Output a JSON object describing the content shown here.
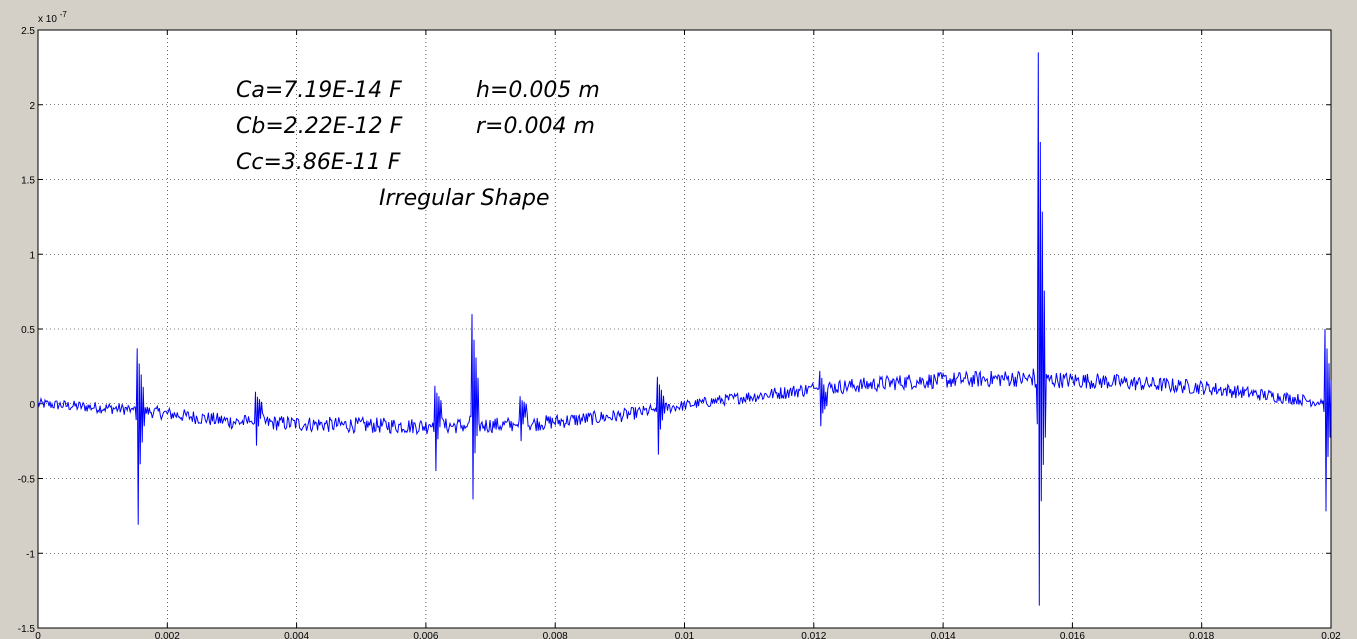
{
  "chart_data": {
    "type": "line",
    "title": "",
    "xlabel": "",
    "ylabel": "",
    "xlim": [
      0,
      0.02
    ],
    "ylim": [
      -1.5e-07,
      2.5e-07
    ],
    "y_exponent_label": "x 10",
    "y_exponent_power": "-7",
    "grid": true,
    "line_color": "#0000ff",
    "x_ticks": [
      {
        "value": 0,
        "label": "0"
      },
      {
        "value": 0.002,
        "label": "0.002"
      },
      {
        "value": 0.004,
        "label": "0.004"
      },
      {
        "value": 0.006,
        "label": "0.006"
      },
      {
        "value": 0.008,
        "label": "0.008"
      },
      {
        "value": 0.01,
        "label": "0.01"
      },
      {
        "value": 0.012,
        "label": "0.012"
      },
      {
        "value": 0.014,
        "label": "0.014"
      },
      {
        "value": 0.016,
        "label": "0.016"
      },
      {
        "value": 0.018,
        "label": "0.018"
      },
      {
        "value": 0.02,
        "label": "0.02"
      }
    ],
    "y_ticks": [
      {
        "value": 2.5,
        "label": "2.5"
      },
      {
        "value": 2,
        "label": "2"
      },
      {
        "value": 1.5,
        "label": "1.5"
      },
      {
        "value": 1,
        "label": "1"
      },
      {
        "value": 0.5,
        "label": "0.5"
      },
      {
        "value": 0,
        "label": "0"
      },
      {
        "value": -0.5,
        "label": "-0.5"
      },
      {
        "value": -1,
        "label": "-1"
      },
      {
        "value": -1.5,
        "label": "-1.5"
      }
    ],
    "annotations": [
      {
        "text": "Ca=7.19E-14 F"
      },
      {
        "text": "Cb=2.22E-12 F"
      },
      {
        "text": "Cc=3.86E-11 F"
      },
      {
        "text": "h=0.005 m"
      },
      {
        "text": "r=0.004 m"
      },
      {
        "text": "Irregular Shape"
      }
    ],
    "series": [
      {
        "values_scale": "1e-7",
        "baseline": [
          [
            0.0,
            0.0
          ],
          [
            0.0015,
            -0.04
          ],
          [
            0.003,
            -0.12
          ],
          [
            0.0045,
            -0.14
          ],
          [
            0.006,
            -0.15
          ],
          [
            0.0075,
            -0.14
          ],
          [
            0.009,
            -0.08
          ],
          [
            0.0097,
            -0.03
          ],
          [
            0.0105,
            0.02
          ],
          [
            0.012,
            0.1
          ],
          [
            0.0135,
            0.15
          ],
          [
            0.015,
            0.17
          ],
          [
            0.0165,
            0.15
          ],
          [
            0.018,
            0.11
          ],
          [
            0.0195,
            0.03
          ],
          [
            0.02,
            0.0
          ]
        ],
        "peaks": [
          {
            "x": 0.00153,
            "max": 0.37,
            "min": -0.81
          },
          {
            "x": 0.00336,
            "max": 0.08,
            "min": -0.28
          },
          {
            "x": 0.00614,
            "max": 0.12,
            "min": -0.45
          },
          {
            "x": 0.00672,
            "max": 0.6,
            "min": -0.64
          },
          {
            "x": 0.00745,
            "max": 0.05,
            "min": -0.25
          },
          {
            "x": 0.00958,
            "max": 0.18,
            "min": -0.34
          },
          {
            "x": 0.0121,
            "max": 0.22,
            "min": -0.15
          },
          {
            "x": 0.01548,
            "max": 2.35,
            "min": -1.35
          },
          {
            "x": 0.0199,
            "max": 0.5,
            "min": -0.72
          }
        ]
      }
    ]
  }
}
